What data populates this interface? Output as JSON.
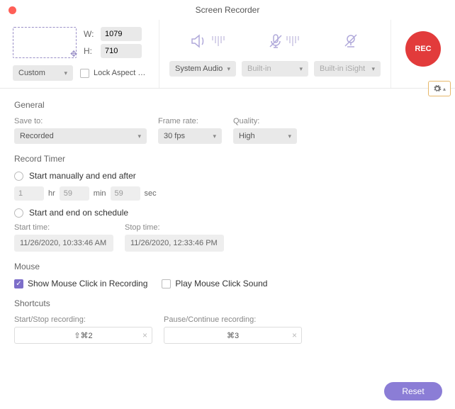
{
  "title": "Screen Recorder",
  "area": {
    "width_label": "W:",
    "height_label": "H:",
    "width": "1079",
    "height": "710",
    "preset": "Custom",
    "lock_aspect_label": "Lock Aspect R..."
  },
  "audio": {
    "system": "System Audio",
    "mic": "Built-in",
    "camera": "Built-in iSight"
  },
  "rec_label": "REC",
  "general": {
    "title": "General",
    "save_to_label": "Save to:",
    "save_to_value": "Recorded",
    "frame_rate_label": "Frame rate:",
    "frame_rate_value": "30 fps",
    "quality_label": "Quality:",
    "quality_value": "High"
  },
  "timer": {
    "title": "Record Timer",
    "manual_label": "Start manually and end after",
    "hr_val": "1",
    "hr": "hr",
    "min_val": "59",
    "min": "min",
    "sec_val": "59",
    "sec": "sec",
    "schedule_label": "Start and end on schedule",
    "start_time_label": "Start time:",
    "start_time": "11/26/2020, 10:33:46 AM",
    "stop_time_label": "Stop time:",
    "stop_time": "11/26/2020, 12:33:46 PM"
  },
  "mouse": {
    "title": "Mouse",
    "show_click": "Show Mouse Click in Recording",
    "play_sound": "Play Mouse Click Sound"
  },
  "shortcuts": {
    "title": "Shortcuts",
    "start_label": "Start/Stop recording:",
    "start_value": "⇧⌘2",
    "pause_label": "Pause/Continue recording:",
    "pause_value": "⌘3"
  },
  "reset": "Reset"
}
